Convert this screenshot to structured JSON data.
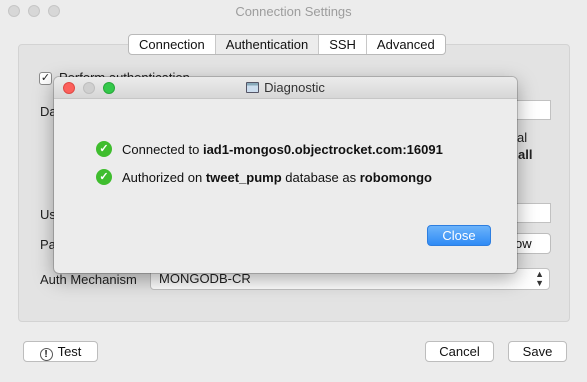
{
  "window": {
    "title": "Connection Settings"
  },
  "tabs": [
    "Connection",
    "Authentication",
    "SSH",
    "Advanced"
  ],
  "auth": {
    "perform_label": "Perform authentication",
    "database_label_fragment": "Da",
    "user_label_fragment": "Us",
    "password_label_fragment": "Pa",
    "side_text_1": "al",
    "side_text_2": "all",
    "show_button_fragment": "ow",
    "mechanism_label": "Auth Mechanism",
    "mechanism_value": "MONGODB-CR"
  },
  "footer": {
    "test_label": "Test",
    "cancel_label": "Cancel",
    "save_label": "Save"
  },
  "dialog": {
    "title": "Diagnostic",
    "line1": {
      "prefix": "Connected to ",
      "host": "iad1-mongos0.objectrocket.com:16091"
    },
    "line2": {
      "prefix": "Authorized on ",
      "database": "tweet_pump",
      "middle": " database as ",
      "user": "robomongo"
    },
    "close_label": "Close"
  },
  "colors": {
    "success": "#3fbd2e",
    "primary_button": "#2f8bf5",
    "close_light": "#fc605c",
    "zoom_light": "#34c84a"
  }
}
